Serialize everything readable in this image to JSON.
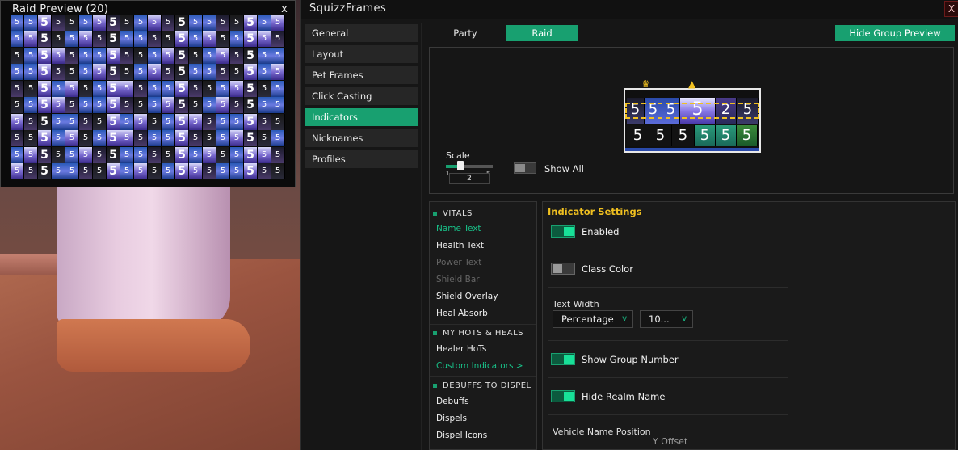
{
  "raid_preview": {
    "title": "Raid Preview (20)",
    "close_label": "x"
  },
  "main_window": {
    "title": "SquizzFrames",
    "close_label": "X"
  },
  "sidebar": {
    "items": [
      {
        "label": "General"
      },
      {
        "label": "Layout"
      },
      {
        "label": "Pet Frames"
      },
      {
        "label": "Click Casting"
      },
      {
        "label": "Indicators",
        "active": true
      },
      {
        "label": "Nicknames"
      },
      {
        "label": "Profiles"
      }
    ]
  },
  "tabs": {
    "party": "Party",
    "raid": "Raid",
    "hide_preview": "Hide Group Preview"
  },
  "preview": {
    "scale_label": "Scale",
    "scale_min": "1",
    "scale_max": "5",
    "scale_value": "2",
    "show_all_label": "Show All",
    "frame_number": "5",
    "frame_superscript": "2"
  },
  "indicator_list": {
    "sections": [
      {
        "header": "VITALS",
        "items": [
          "Name Text",
          "Health Text",
          "Power Text",
          "Shield Bar",
          "Shield Overlay",
          "Heal Absorb"
        ]
      },
      {
        "header": "MY HOTS & HEALS",
        "items": [
          "Healer HoTs",
          "Custom Indicators >"
        ]
      },
      {
        "header": "DEBUFFS TO DISPEL",
        "items": [
          "Debuffs",
          "Dispels",
          "Dispel Icons"
        ]
      }
    ]
  },
  "settings": {
    "title": "Indicator Settings",
    "enabled_label": "Enabled",
    "enabled": true,
    "class_color_label": "Class Color",
    "class_color": false,
    "text_width_label": "Text Width",
    "text_width_mode": "Percentage",
    "text_width_value": "10...",
    "show_group_number_label": "Show Group Number",
    "show_group_number": true,
    "hide_realm_name_label": "Hide Realm Name",
    "hide_realm_name": true,
    "vehicle_name_position_label": "Vehicle Name Position",
    "cutoff_label": "Y Offset"
  },
  "colors": {
    "accent": "#18a070",
    "title_gold": "#f0c020"
  }
}
